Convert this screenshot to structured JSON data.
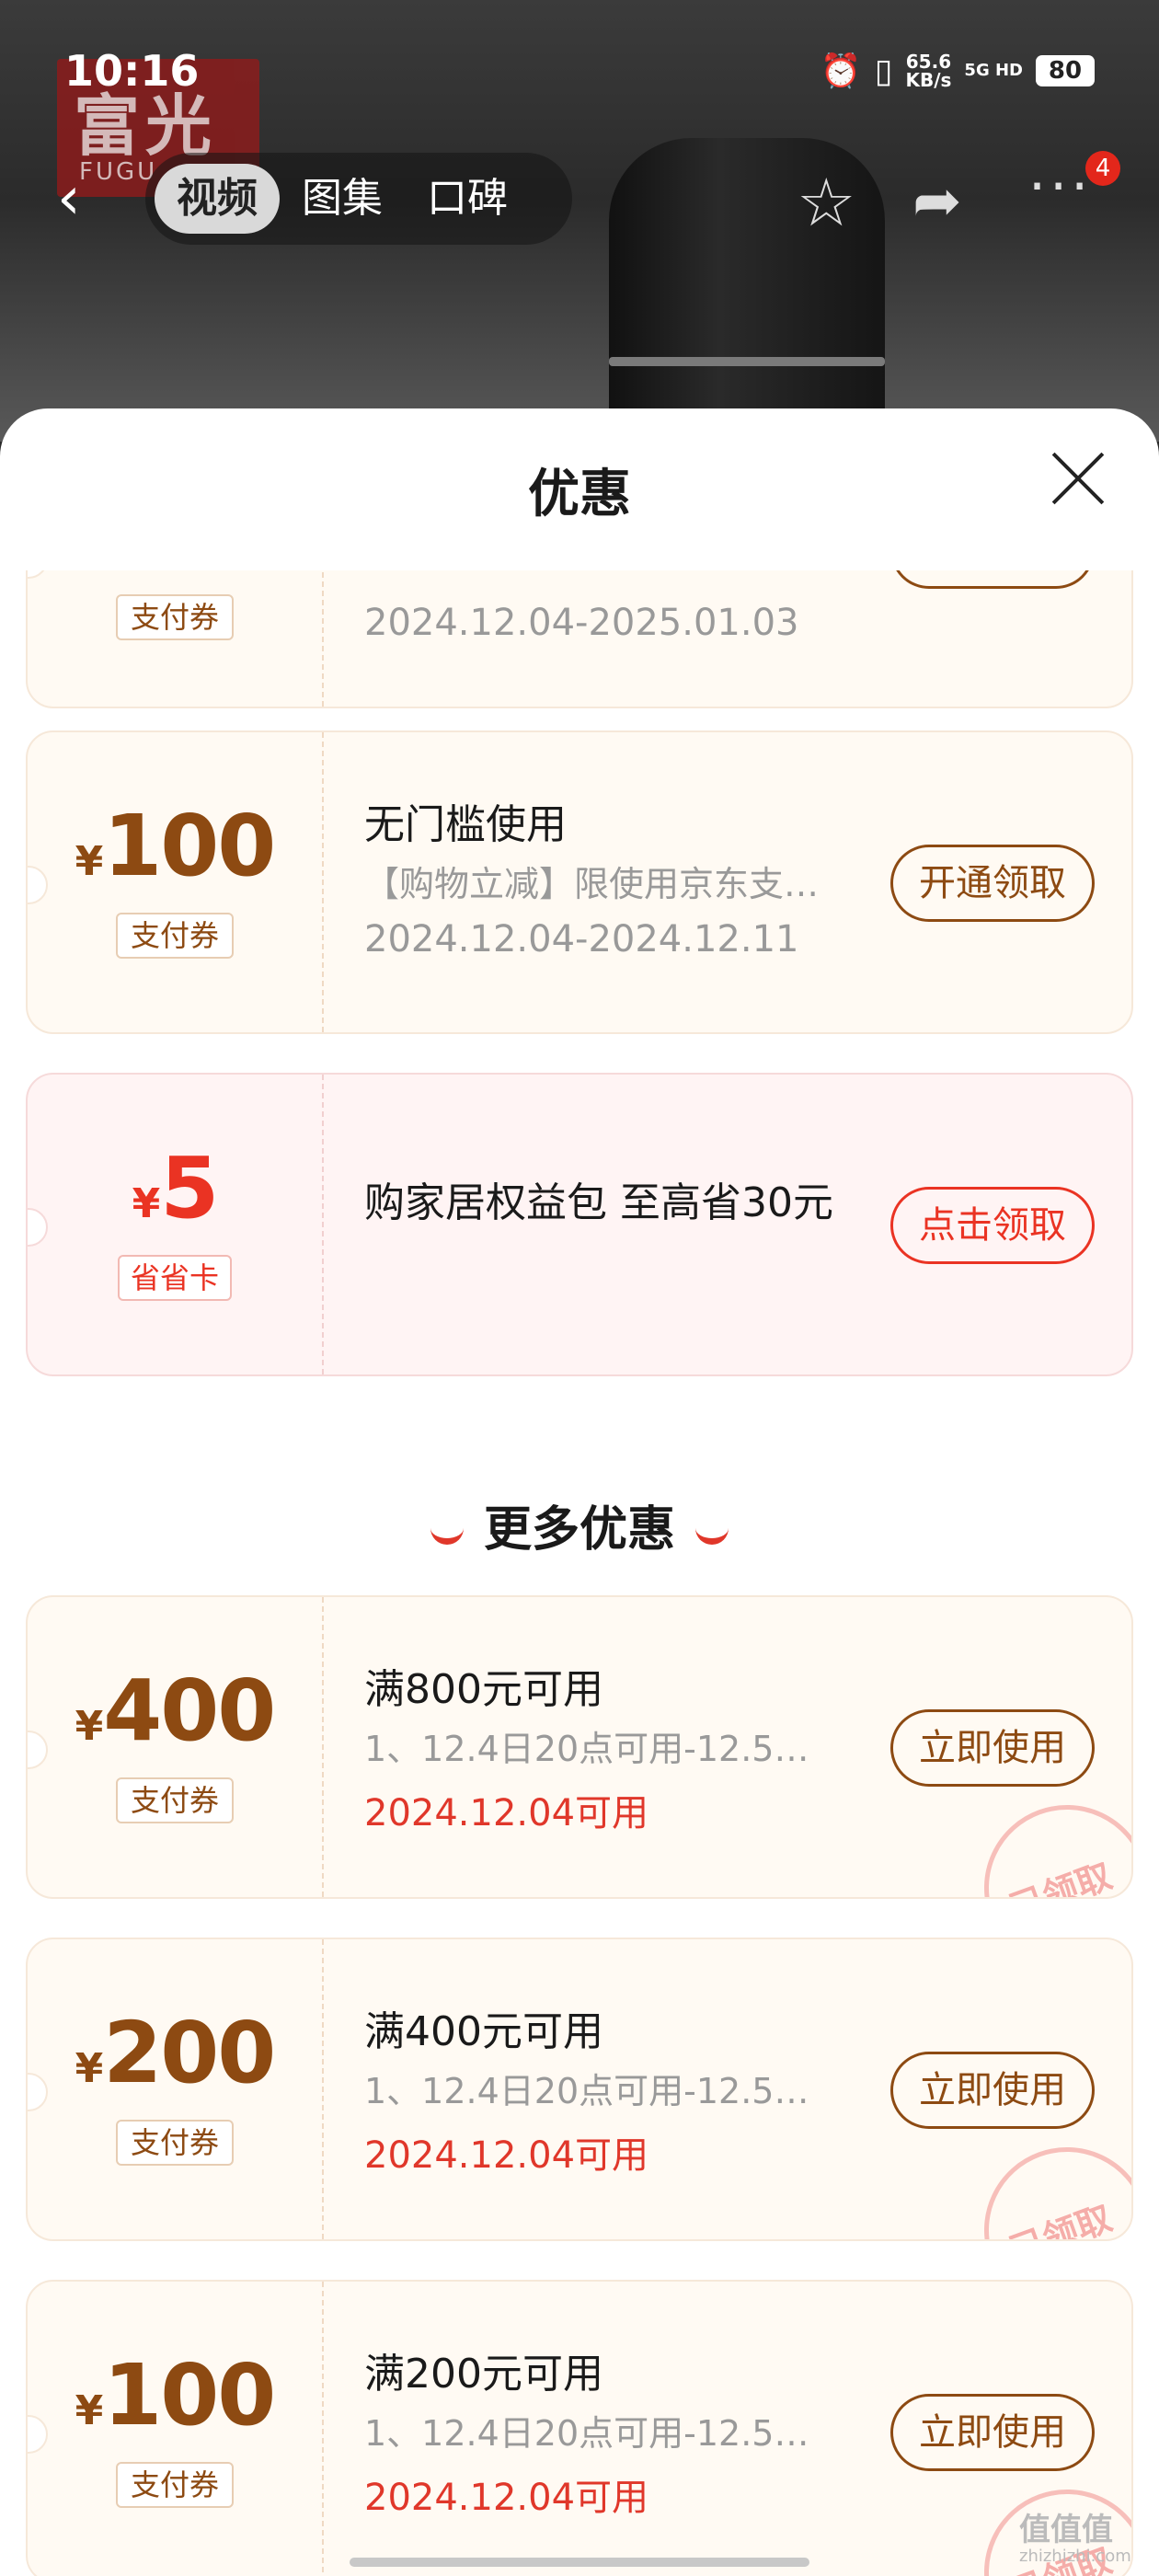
{
  "status": {
    "time": "10:16",
    "net_speed": "65.6",
    "net_unit": "KB/s",
    "signal": "5G HD",
    "battery": "80"
  },
  "brand": {
    "logo_text": "富光",
    "logo_sub": "FUGU"
  },
  "nav": {
    "tabs": [
      "视频",
      "图集",
      "口碑"
    ],
    "notification_count": "4"
  },
  "sheet": {
    "title": "优惠"
  },
  "coupons": [
    {
      "tag": "支付券",
      "date": "2024.12.04-2025.01.03"
    },
    {
      "currency": "¥",
      "amount": "100",
      "tag": "支付券",
      "title": "无门槛使用",
      "desc": "【购物立减】限使用京东支…",
      "date": "2024.12.04-2024.12.11",
      "action": "开通领取"
    },
    {
      "currency": "¥",
      "amount": "5",
      "tag": "省省卡",
      "title": "购家居权益包 至高省30元",
      "action": "点击领取"
    }
  ],
  "more_section": {
    "title": "更多优惠"
  },
  "more_coupons": [
    {
      "currency": "¥",
      "amount": "400",
      "tag": "支付券",
      "title": "满800元可用",
      "desc": "1、12.4日20点可用-12.5…",
      "date": "2024.12.04可用",
      "action": "立即使用",
      "stamp": "已领取"
    },
    {
      "currency": "¥",
      "amount": "200",
      "tag": "支付券",
      "title": "满400元可用",
      "desc": "1、12.4日20点可用-12.5…",
      "date": "2024.12.04可用",
      "action": "立即使用",
      "stamp": "已领取"
    },
    {
      "currency": "¥",
      "amount": "100",
      "tag": "支付券",
      "title": "满200元可用",
      "desc": "1、12.4日20点可用-12.5…",
      "date": "2024.12.04可用",
      "action": "立即使用",
      "stamp": "已领取"
    }
  ],
  "watermark": {
    "text": "值值值",
    "sub": "zhizhizhi.com"
  },
  "colors": {
    "brown": "#8d4a12",
    "red": "#ea3323",
    "coupon_bg": "#fffaf3",
    "coupon_bg_pink": "#fff4f4"
  }
}
